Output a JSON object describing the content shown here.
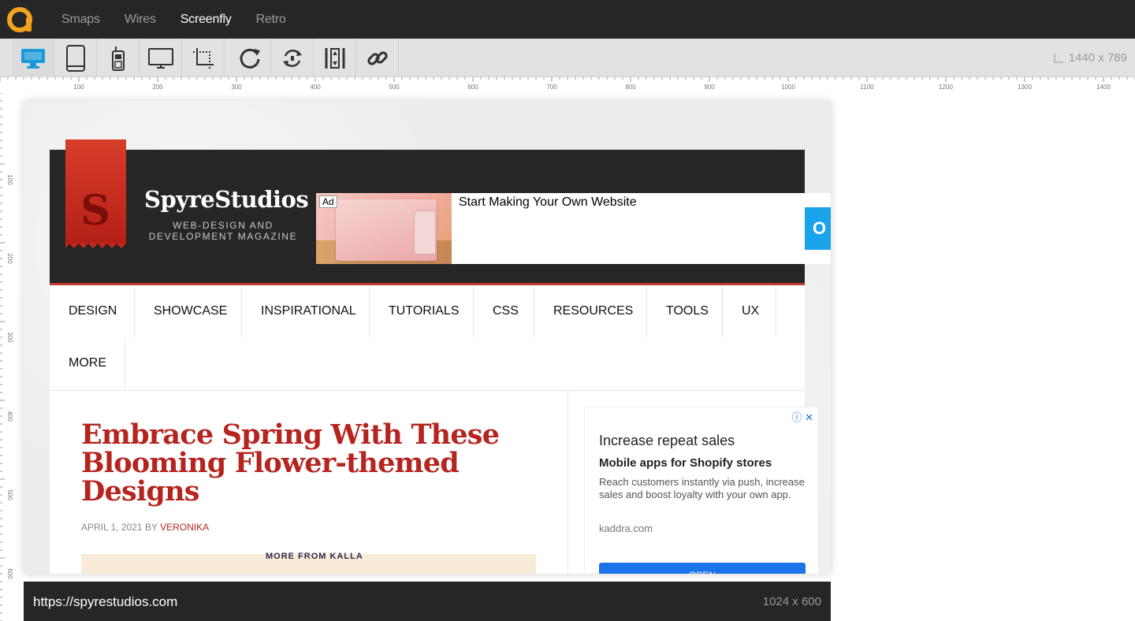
{
  "app": {
    "nav": [
      {
        "label": "Smaps"
      },
      {
        "label": "Wires"
      },
      {
        "label": "Screenfly"
      },
      {
        "label": "Retro"
      }
    ],
    "active_nav": "Screenfly"
  },
  "toolbar": {
    "tools": [
      "desktop-icon",
      "tablet-icon",
      "mobile-icon",
      "tv-icon",
      "crop-icon",
      "refresh-icon",
      "rotate-icon",
      "scroll-icon",
      "link-icon"
    ],
    "active_tool": "desktop-icon",
    "screen_size": "1440 x 789"
  },
  "rulers": {
    "top_labels": [
      "100",
      "200",
      "300",
      "400",
      "500",
      "600",
      "700",
      "800",
      "900",
      "1000",
      "1100",
      "1200",
      "1300",
      "1400"
    ],
    "left_labels": [
      "100",
      "200",
      "300",
      "400",
      "500",
      "600"
    ]
  },
  "site": {
    "brand_title": "SpyreStudios",
    "brand_letter": "S",
    "brand_subtitle": "WEB-DESIGN AND DEVELOPMENT MAGAZINE",
    "ad_banner": {
      "badge": "Ad",
      "headline": "Start Making Your Own Website",
      "button_partial": "O"
    },
    "nav": [
      "DESIGN",
      "SHOWCASE",
      "INSPIRATIONAL",
      "TUTORIALS",
      "CSS",
      "RESOURCES",
      "TOOLS",
      "UX",
      "MORE"
    ],
    "post": {
      "title": "Embrace Spring With These Blooming Flower-themed Designs",
      "date": "APRIL 1, 2021",
      "by": "BY",
      "author": "VERONIKA",
      "image_caption": "MORE FROM KALLA"
    },
    "side_ad": {
      "headline": "Increase repeat sales",
      "subheadline": "Mobile apps for Shopify stores",
      "body": "Reach customers instantly via push, increase sales and boost loyalty with your own app.",
      "domain": "kaddra.com",
      "button": "OPEN",
      "icons": "ⓘ ✕"
    }
  },
  "footer": {
    "url": "https://spyrestudios.com",
    "viewport": "1024 x 600"
  },
  "colors": {
    "accent_blue": "#1a9ad6",
    "brand_red": "#b5241e",
    "dark_bar": "#262626"
  }
}
